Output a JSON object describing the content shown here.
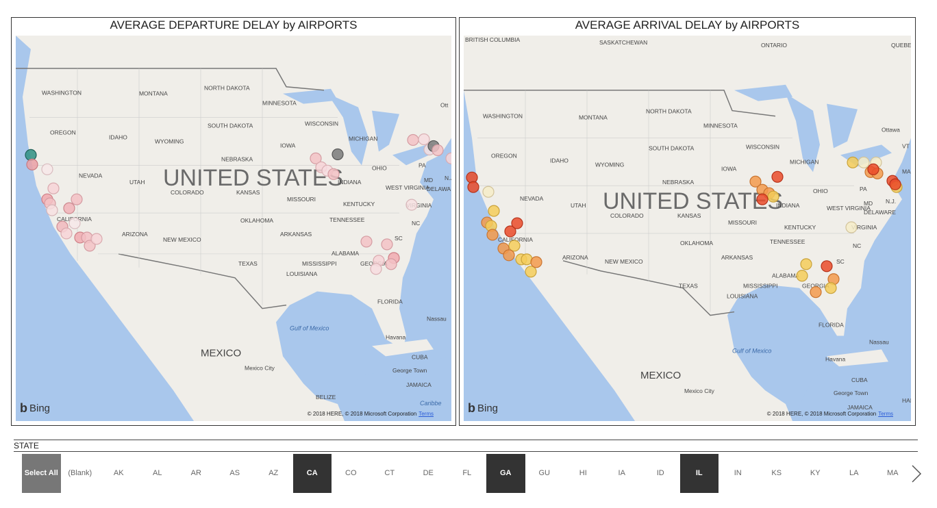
{
  "left_map": {
    "title": "AVERAGE DEPARTURE DELAY by AIRPORTS",
    "country_label": "UNITED STATES",
    "mexico_label": "MEXICO",
    "labels": [
      "WASHINGTON",
      "MONTANA",
      "NORTH DAKOTA",
      "MINNESOTA",
      "OREGON",
      "IDAHO",
      "SOUTH DAKOTA",
      "WISCONSIN",
      "WYOMING",
      "IOWA",
      "MICHIGAN",
      "NEBRASKA",
      "NEVADA",
      "UTAH",
      "COLORADO",
      "KANSAS",
      "MISSOURI",
      "INDIANA",
      "OHIO",
      "WEST VIRGINIA",
      "KENTUCKY",
      "VIRGINIA",
      "CALIFORNIA",
      "OKLAHOMA",
      "TENNESSEE",
      "NC",
      "ARIZONA",
      "NEW MEXICO",
      "ARKANSAS",
      "SC",
      "TEXAS",
      "MISSISSIPPI",
      "ALABAMA",
      "GEORGIA",
      "LOUISIANA",
      "FLORIDA",
      "PA",
      "MD",
      "N.J.",
      "DELAWA",
      "Ott",
      "Nassau",
      "Havana",
      "CUBA",
      "George Town",
      "JAMAICA",
      "BELIZE",
      "Mexico City",
      "Gulf of Mexico",
      "Caribbe"
    ],
    "bing": "Bing",
    "copyright": "© 2018 HERE, © 2018 Microsoft Corporation",
    "terms": "Terms"
  },
  "right_map": {
    "title": "AVERAGE ARRIVAL DELAY by AIRPORTS",
    "country_label": "UNITED STATES",
    "mexico_label": "MEXICO",
    "labels": [
      "BRITISH COLUMBIA",
      "SASKATCHEWAN",
      "ONTARIO",
      "QUEBEC",
      "WASHINGTON",
      "MONTANA",
      "NORTH DAKOTA",
      "MINNESOTA",
      "Ottawa",
      "OREGON",
      "IDAHO",
      "WYOMING",
      "SOUTH DAKOTA",
      "WISCONSIN",
      "MICHIGAN",
      "IOWA",
      "NEBRASKA",
      "NEVADA",
      "UTAH",
      "COLORADO",
      "KANSAS",
      "MISSOURI",
      "INDIANA",
      "OHIO",
      "PA",
      "WEST VIRGINIA",
      "MD",
      "DELAWARE",
      "N.J.",
      "KENTUCKY",
      "VIRGINIA",
      "CALIFORNIA",
      "OKLAHOMA",
      "TENNESSEE",
      "NC",
      "ARIZONA",
      "NEW MEXICO",
      "ARKANSAS",
      "SC",
      "TEXAS",
      "MISSISSIPPI",
      "ALABAMA",
      "GEORGIA",
      "LOUISIANA",
      "FLORIDA",
      "Nassau",
      "Havana",
      "CUBA",
      "George Town",
      "JAMAICA",
      "HAITI",
      "Mexico City",
      "Gulf of Mexico",
      "VT",
      "MAS"
    ],
    "bing": "Bing",
    "copyright": "© 2018 HERE, © 2018 Microsoft Corporation",
    "terms": "Terms"
  },
  "slicer": {
    "header": "STATE",
    "items": [
      {
        "label": "Select All",
        "kind": "all"
      },
      {
        "label": "(Blank)",
        "kind": ""
      },
      {
        "label": "AK",
        "kind": ""
      },
      {
        "label": "AL",
        "kind": ""
      },
      {
        "label": "AR",
        "kind": ""
      },
      {
        "label": "AS",
        "kind": ""
      },
      {
        "label": "AZ",
        "kind": ""
      },
      {
        "label": "CA",
        "kind": "sel"
      },
      {
        "label": "CO",
        "kind": ""
      },
      {
        "label": "CT",
        "kind": ""
      },
      {
        "label": "DE",
        "kind": ""
      },
      {
        "label": "FL",
        "kind": ""
      },
      {
        "label": "GA",
        "kind": "sel"
      },
      {
        "label": "GU",
        "kind": ""
      },
      {
        "label": "HI",
        "kind": ""
      },
      {
        "label": "IA",
        "kind": ""
      },
      {
        "label": "ID",
        "kind": ""
      },
      {
        "label": "IL",
        "kind": "sel"
      },
      {
        "label": "IN",
        "kind": ""
      },
      {
        "label": "KS",
        "kind": ""
      },
      {
        "label": "KY",
        "kind": ""
      },
      {
        "label": "LA",
        "kind": ""
      },
      {
        "label": "MA",
        "kind": ""
      }
    ]
  },
  "colors": {
    "land": "#f0eee9",
    "water": "#a9c7ec",
    "border": "#6f6f6f",
    "dep_pink": "#f2b3b9",
    "dep_light": "#f7dcdf",
    "dep_teal": "#2f8f83",
    "dep_gray": "#7a7a7a",
    "arr_red": "#ea4b2a",
    "arr_orange": "#f39a4c",
    "arr_yellow": "#f4cd5a",
    "arr_pale": "#f6ecc8"
  }
}
